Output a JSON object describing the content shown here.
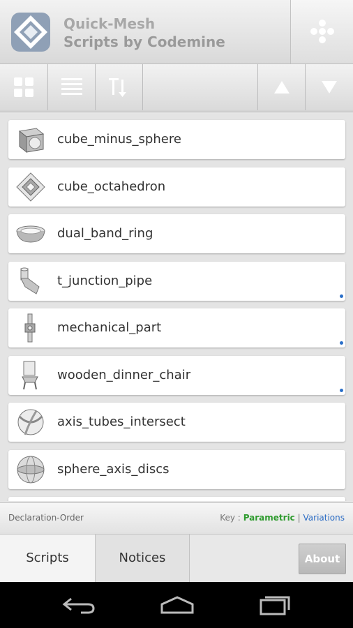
{
  "app": {
    "title": "Quick-Mesh",
    "subtitle": "Scripts by Codemine"
  },
  "scripts": [
    {
      "name": "cube_minus_sphere",
      "icon": "cube-minus-sphere-icon",
      "variation": false
    },
    {
      "name": "cube_octahedron",
      "icon": "cube-octahedron-icon",
      "variation": false
    },
    {
      "name": "dual_band_ring",
      "icon": "ring-icon",
      "variation": false
    },
    {
      "name": "t_junction_pipe",
      "icon": "pipe-icon",
      "variation": true
    },
    {
      "name": "mechanical_part",
      "icon": "mechanical-part-icon",
      "variation": true
    },
    {
      "name": "wooden_dinner_chair",
      "icon": "chair-icon",
      "variation": true
    },
    {
      "name": "axis_tubes_intersect",
      "icon": "tubes-icon",
      "variation": false
    },
    {
      "name": "sphere_axis_discs",
      "icon": "sphere-discs-icon",
      "variation": false
    }
  ],
  "status": {
    "sort_order": "Declaration-Order",
    "key_label": "Key :",
    "key_parametric": "Parametric",
    "key_separator": "|",
    "key_variations": "Variations"
  },
  "tabs": {
    "scripts": "Scripts",
    "notices": "Notices",
    "about": "About"
  },
  "colors": {
    "parametric": "#2e9b2e",
    "variations": "#2b6cc4"
  }
}
